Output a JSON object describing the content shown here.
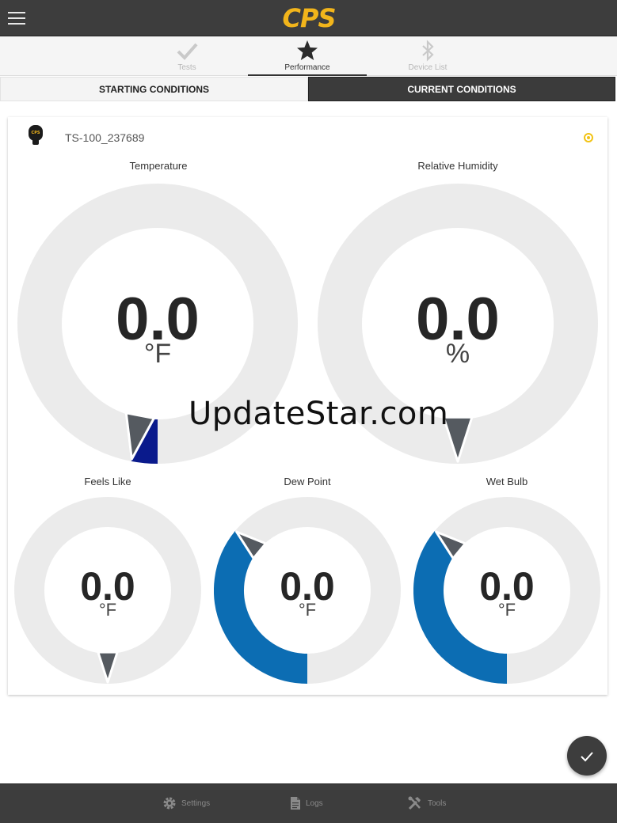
{
  "header": {
    "logo_text": "CPS",
    "menu_icon": "hamburger-menu-icon"
  },
  "nav_tabs": [
    {
      "label": "Tests",
      "icon": "checkmark-icon",
      "active": false
    },
    {
      "label": "Performance",
      "icon": "star-icon",
      "active": true
    },
    {
      "label": "Device List",
      "icon": "bluetooth-icon",
      "active": false
    }
  ],
  "segments": {
    "starting": "STARTING CONDITIONS",
    "current": "CURRENT CONDITIONS",
    "selected": "current"
  },
  "device": {
    "name": "TS-100_237689",
    "status_color": "#f2c315"
  },
  "gauges": {
    "temperature": {
      "title": "Temperature",
      "value": "0.0",
      "unit": "°F",
      "arc_color": "#0a1a8c",
      "fill_fraction": 0.03
    },
    "humidity": {
      "title": "Relative Humidity",
      "value": "0.0",
      "unit": "%",
      "arc_color": "#0a1a8c",
      "fill_fraction": 0
    },
    "feels_like": {
      "title": "Feels Like",
      "value": "0.0",
      "unit": "°F",
      "arc_color": "#0c6db3",
      "fill_fraction": 0
    },
    "dew_point": {
      "title": "Dew Point",
      "value": "0.0",
      "unit": "°F",
      "arc_color": "#0c6db3",
      "fill_fraction": 0.36
    },
    "wet_bulb": {
      "title": "Wet Bulb",
      "value": "0.0",
      "unit": "°F",
      "arc_color": "#0c6db3",
      "fill_fraction": 0.36
    }
  },
  "watermark": "UpdateStar.com",
  "fab_icon": "check-icon",
  "bottom_tabs": [
    {
      "label": "Settings",
      "icon": "gear-icon"
    },
    {
      "label": "Logs",
      "icon": "document-icon"
    },
    {
      "label": "Tools",
      "icon": "tools-icon"
    }
  ],
  "colors": {
    "bar": "#3d3d3d",
    "accent": "#f2b51b",
    "ring": "#ebebeb"
  }
}
